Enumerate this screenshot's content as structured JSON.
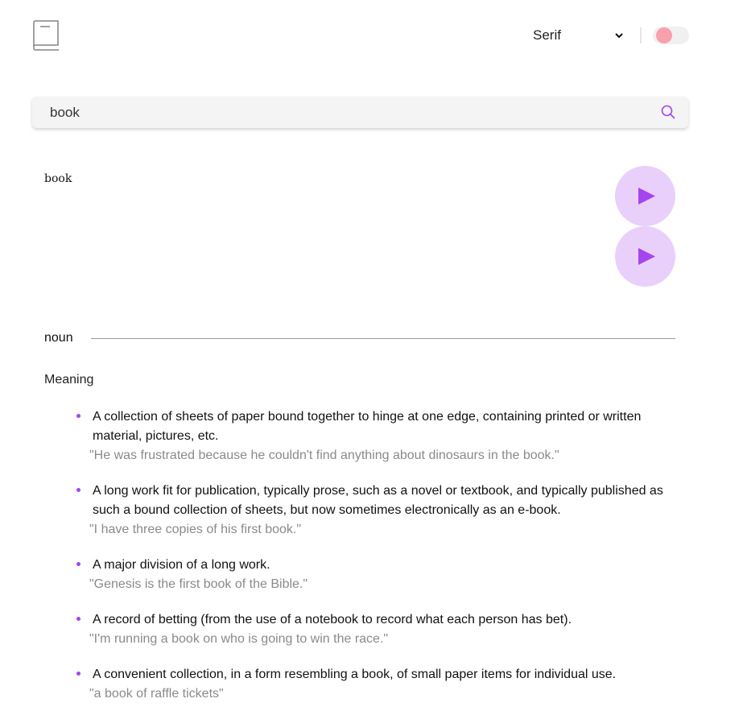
{
  "colors": {
    "accent": "#a445ed",
    "play_bg": "#e9d0fb",
    "toggle_knob": "#f7a1ad",
    "search_bg": "#f4f4f5"
  },
  "header": {
    "logo_icon": "book-icon",
    "font_select": {
      "value": "Serif",
      "icon": "chevron-down-icon"
    },
    "theme_toggle": {
      "state": "off"
    }
  },
  "search": {
    "value": "book",
    "icon": "search-icon"
  },
  "word": {
    "title": "book",
    "play_buttons": [
      "play-icon",
      "play-icon"
    ]
  },
  "part_of_speech": "noun",
  "meaning_heading": "Meaning",
  "definitions": [
    {
      "text": "A collection of sheets of paper bound together to hinge at one edge, containing printed or written material, pictures, etc.",
      "example": "\"He was frustrated because he couldn't find anything about dinosaurs in the book.\""
    },
    {
      "text": "A long work fit for publication, typically prose, such as a novel or textbook, and typically published as such a bound collection of sheets, but now sometimes electronically as an e-book.",
      "example": "\"I have three copies of his first book.\""
    },
    {
      "text": "A major division of a long work.",
      "example": "\"Genesis is the first book of the Bible.\""
    },
    {
      "text": "A record of betting (from the use of a notebook to record what each person has bet).",
      "example": "\"I'm running a book on who is going to win the race.\""
    },
    {
      "text": "A convenient collection, in a form resembling a book, of small paper items for individual use.",
      "example": "\"a book of raffle tickets\""
    }
  ]
}
